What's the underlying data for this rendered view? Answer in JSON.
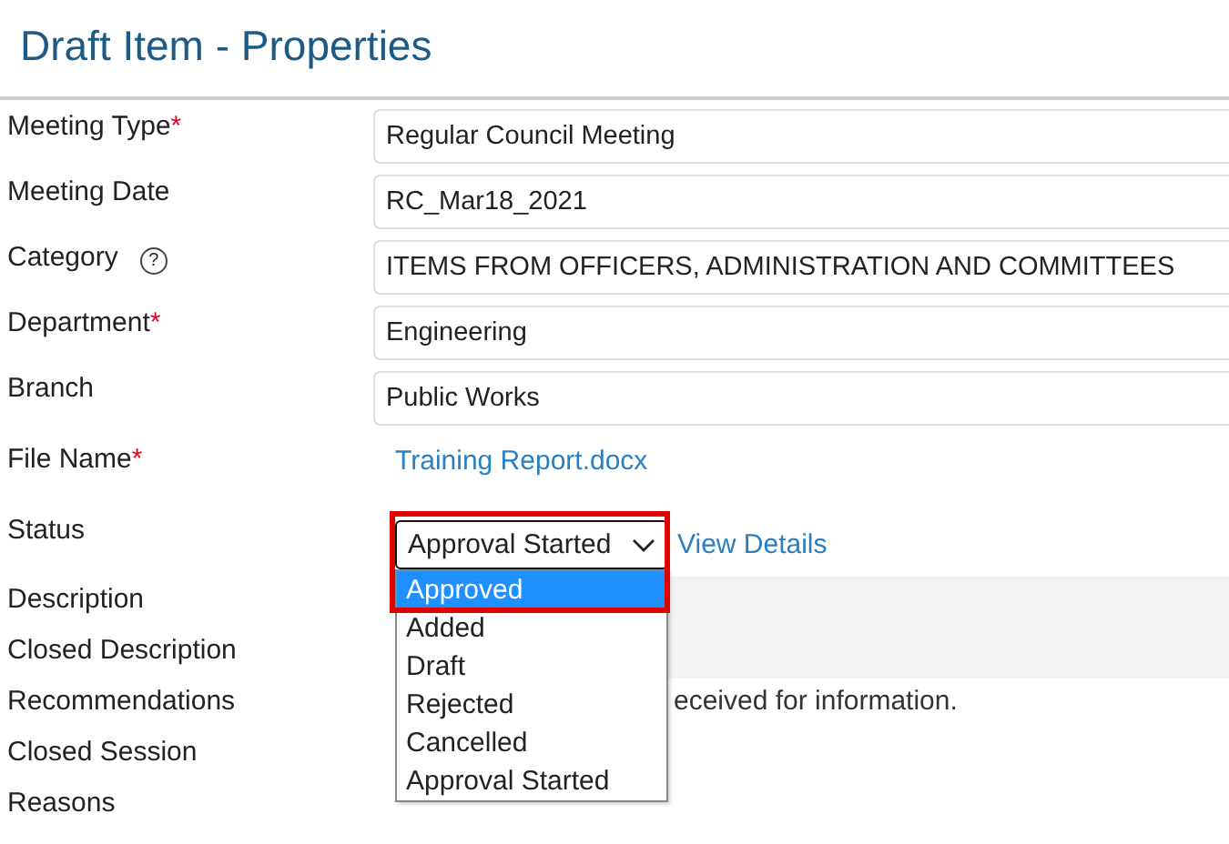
{
  "title": "Draft Item - Properties",
  "fields": [
    {
      "kind": "input",
      "label": "Meeting Type",
      "required_mark": "*",
      "value": "Regular Council Meeting"
    },
    {
      "kind": "input",
      "label": "Meeting Date",
      "value": "RC_Mar18_2021"
    },
    {
      "kind": "input",
      "label": "Category",
      "help": "?",
      "value": "ITEMS FROM OFFICERS, ADMINISTRATION AND COMMITTEES"
    },
    {
      "kind": "input",
      "label": "Department",
      "required_mark": "*",
      "value": "Engineering"
    },
    {
      "kind": "input",
      "label": "Branch",
      "value": "Public Works"
    },
    {
      "kind": "link",
      "label": "File Name",
      "required_mark": "*",
      "value": "Training Report.docx"
    },
    {
      "kind": "select",
      "label": "Status",
      "value": "Approval Started",
      "link": "View Details",
      "options": [
        {
          "label": "Approved",
          "highlighted": true
        },
        {
          "label": "Added",
          "highlighted": false
        },
        {
          "label": "Draft",
          "highlighted": false
        },
        {
          "label": "Rejected",
          "highlighted": false
        },
        {
          "label": "Cancelled",
          "highlighted": false
        },
        {
          "label": "Approval Started",
          "highlighted": false
        }
      ]
    },
    {
      "kind": "panel",
      "label": "Description"
    },
    {
      "kind": "panel",
      "label": "Closed Description"
    },
    {
      "kind": "text",
      "label": "Recommendations",
      "value": "eceived for information."
    },
    {
      "kind": "text",
      "label": "Closed Session"
    },
    {
      "kind": "text",
      "label": "Reasons"
    }
  ]
}
